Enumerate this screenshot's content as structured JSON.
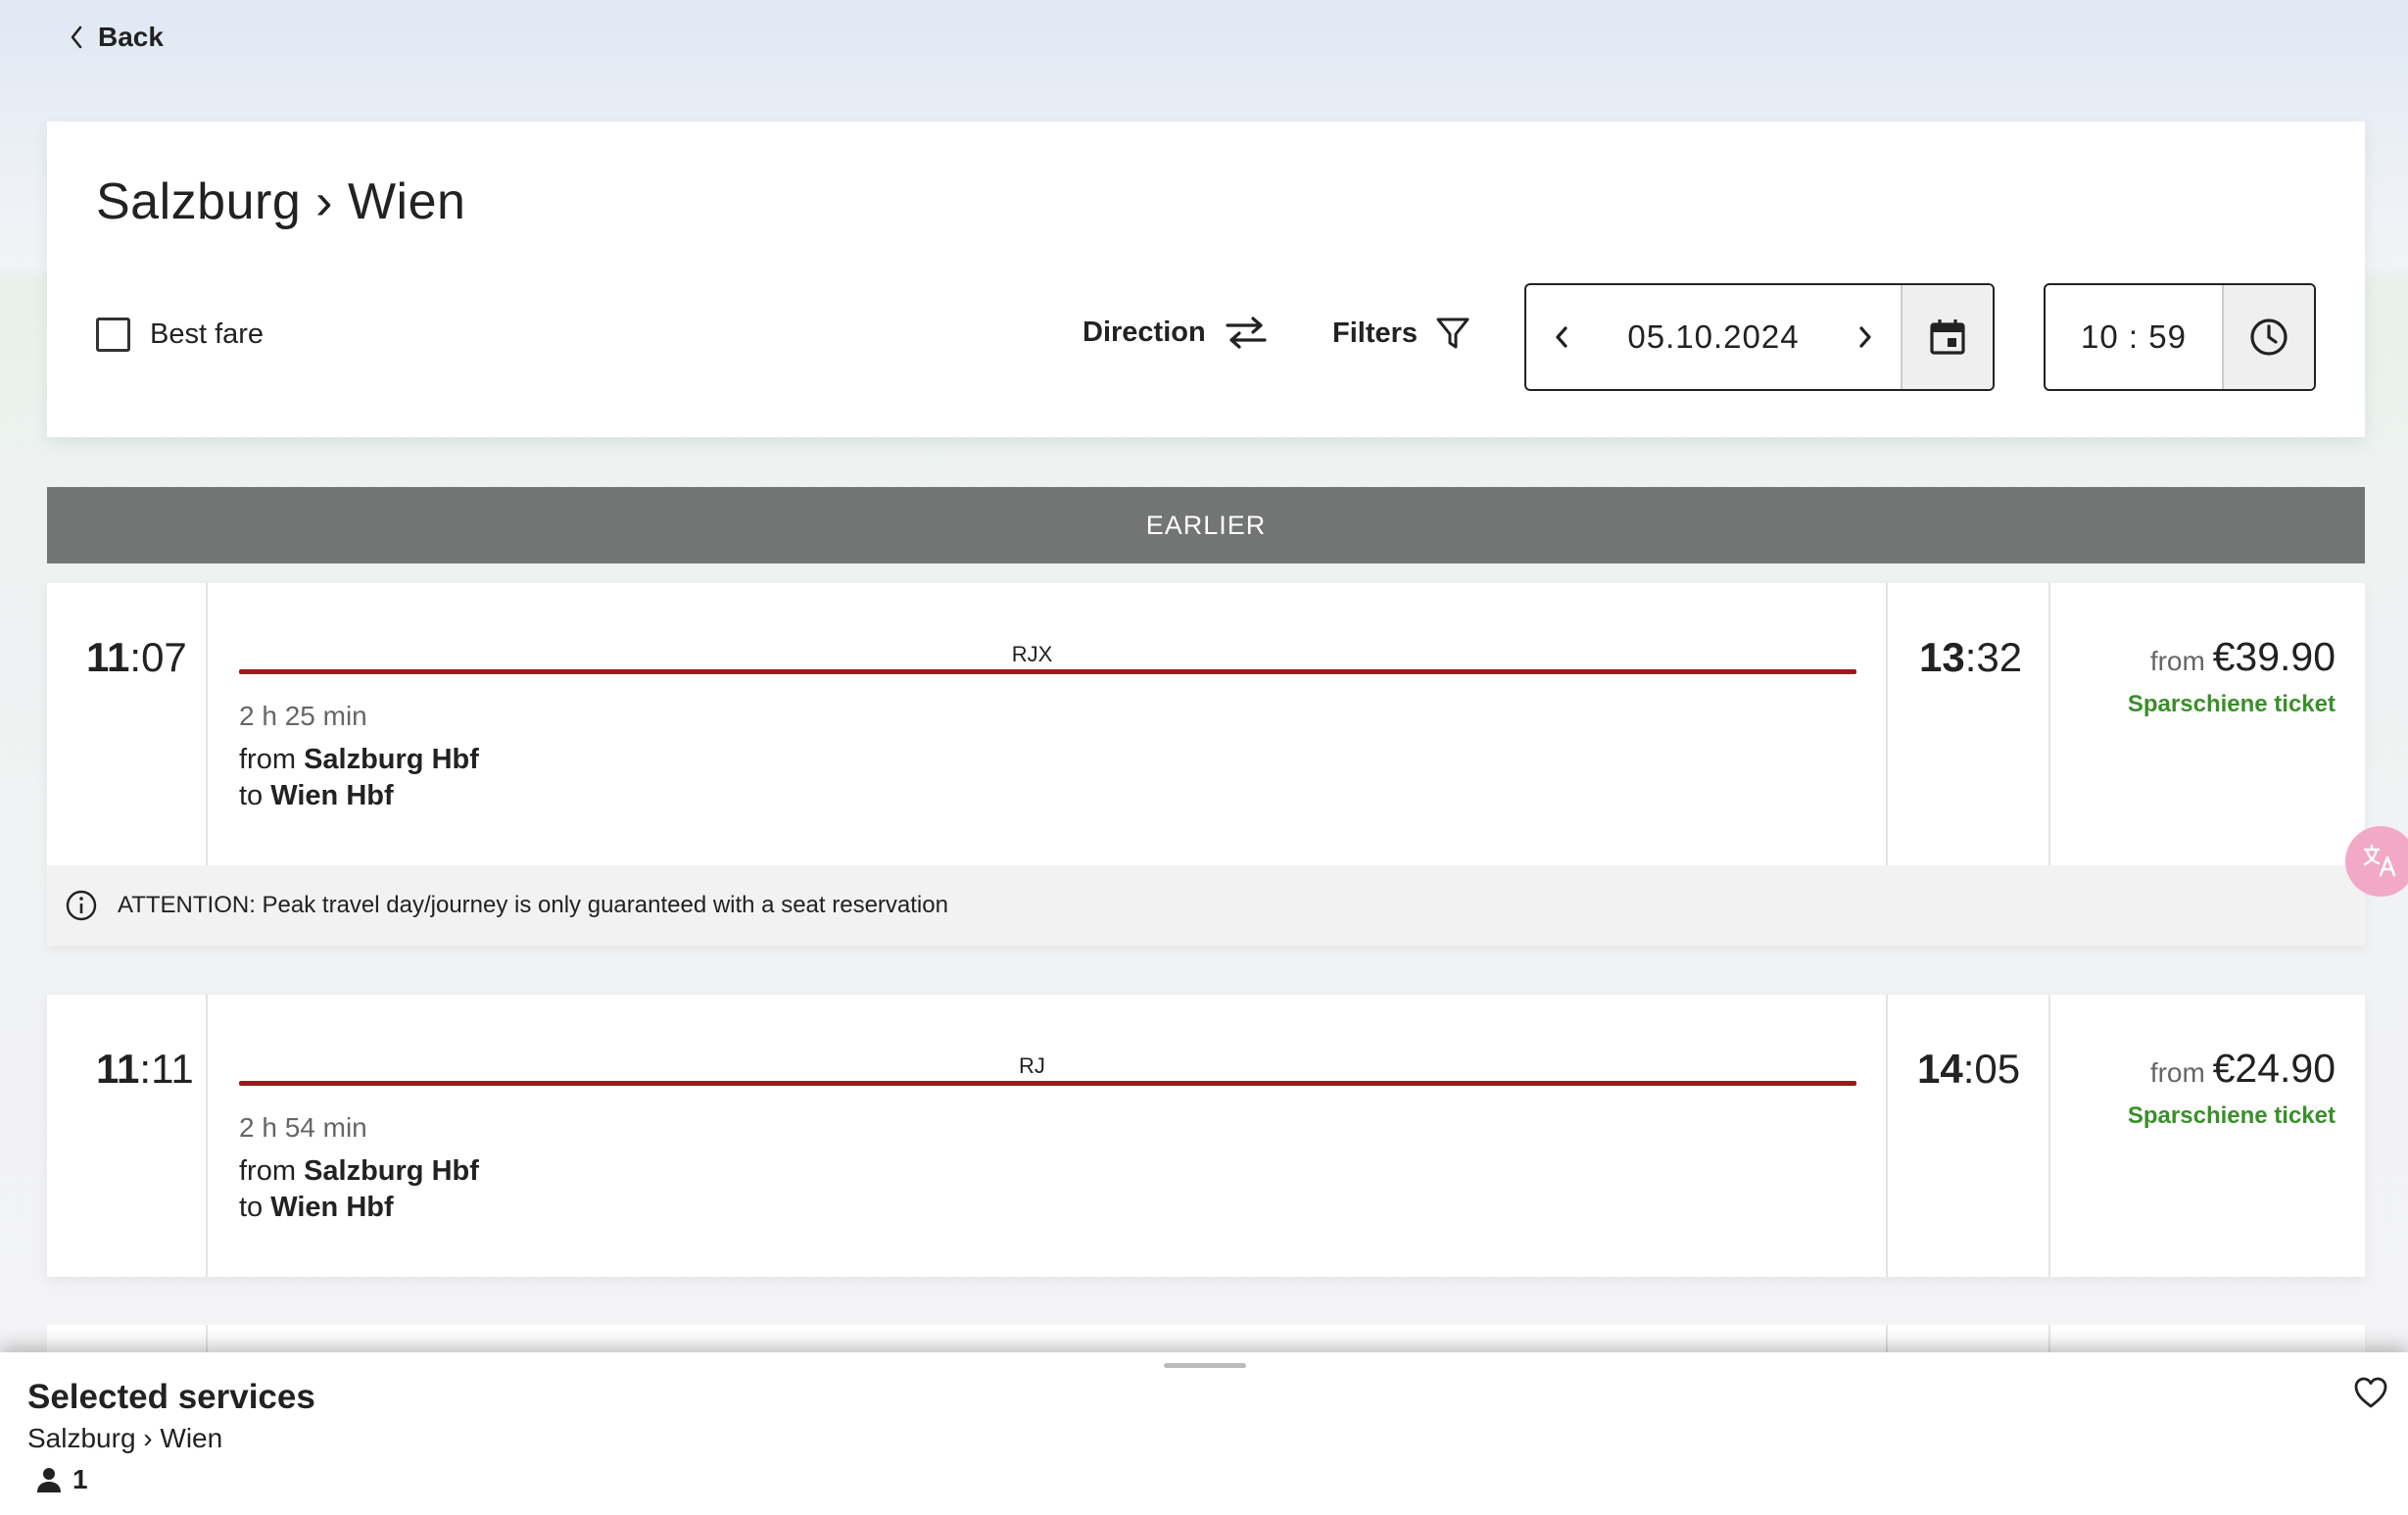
{
  "nav": {
    "back_label": "Back"
  },
  "header": {
    "title": "Salzburg › Wien",
    "best_fare_label": "Best fare",
    "best_fare_checked": false,
    "direction_label": "Direction",
    "filters_label": "Filters",
    "date": "05.10.2024",
    "time": "10 : 59"
  },
  "earlier_label": "EARLIER",
  "connections": [
    {
      "dep_hour": "11",
      "dep_min": ":07",
      "train": "RJX",
      "duration": "2 h 25 min",
      "from_prefix": "from ",
      "from_station": "Salzburg Hbf",
      "to_prefix": "to ",
      "to_station": "Wien Hbf",
      "arr_hour": "13",
      "arr_min": ":32",
      "price_from": "from ",
      "price": "€39.90",
      "ticket": "Sparschiene ticket",
      "attention": "ATTENTION: Peak travel day/journey is only guaranteed with a seat reservation"
    },
    {
      "dep_hour": "11",
      "dep_min": ":11",
      "train": "RJ",
      "duration": "2 h 54 min",
      "from_prefix": "from ",
      "from_station": "Salzburg Hbf",
      "to_prefix": "to ",
      "to_station": "Wien Hbf",
      "arr_hour": "14",
      "arr_min": ":05",
      "price_from": "from ",
      "price": "€24.90",
      "ticket": "Sparschiene ticket"
    }
  ],
  "sheet": {
    "title": "Selected services",
    "route": "Salzburg › Wien",
    "passengers": "1"
  },
  "colors": {
    "accent_red": "#a4161c",
    "ticket_green": "#3a8f2b",
    "earlier_bg": "#737574"
  },
  "icons": [
    "chevron-left-icon",
    "checkbox-icon",
    "swap-arrows-icon",
    "filter-icon",
    "calendar-icon",
    "clock-icon",
    "info-icon",
    "person-icon",
    "heart-icon",
    "translate-icon"
  ]
}
